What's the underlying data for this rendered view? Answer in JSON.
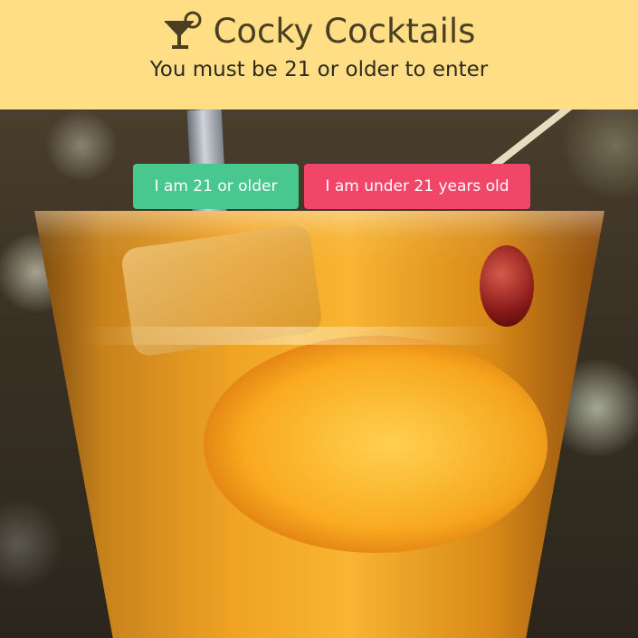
{
  "header": {
    "brand_icon": "cocktail-glass-icon",
    "title": "Cocky Cocktails",
    "subtitle": "You must be 21 or older to enter"
  },
  "background": {
    "image": "whiskey-cocktail-photo"
  },
  "actions": {
    "confirm_label": "I am 21 or older",
    "deny_label": "I am under 21 years old"
  },
  "colors": {
    "header_bg": "#ffde85",
    "title": "#4a3f22",
    "confirm_button": "#48c78e",
    "deny_button": "#f14668"
  }
}
